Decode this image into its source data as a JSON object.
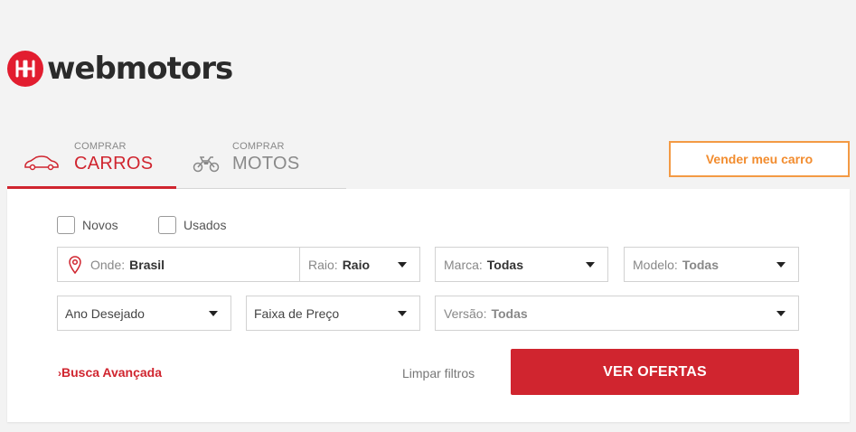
{
  "logo": {
    "text": "webmotors",
    "brand_color": "#e21d2f"
  },
  "tabs": {
    "cars": {
      "small": "COMPRAR",
      "big": "CARROS",
      "icon": "car-icon",
      "active": true
    },
    "motos": {
      "small": "COMPRAR",
      "big": "MOTOS",
      "icon": "motorcycle-icon",
      "active": false
    }
  },
  "sell_button": "Vender meu carro",
  "filters": {
    "new_label": "Novos",
    "used_label": "Usados",
    "location": {
      "label": "Onde:",
      "value": "Brasil"
    },
    "radius": {
      "label": "Raio:",
      "value": "Raio"
    },
    "brand": {
      "label": "Marca:",
      "value": "Todas"
    },
    "model": {
      "label": "Modelo:",
      "value": "Todas"
    },
    "year": {
      "label": "Ano Desejado"
    },
    "price": {
      "label": "Faixa de Preço"
    },
    "version": {
      "label": "Versão:",
      "value": "Todas"
    }
  },
  "actions": {
    "advanced": "Busca Avançada",
    "clear": "Limpar filtros",
    "offers": "VER OFERTAS"
  },
  "colors": {
    "accent": "#d0252f",
    "orange": "#f28c2e"
  }
}
